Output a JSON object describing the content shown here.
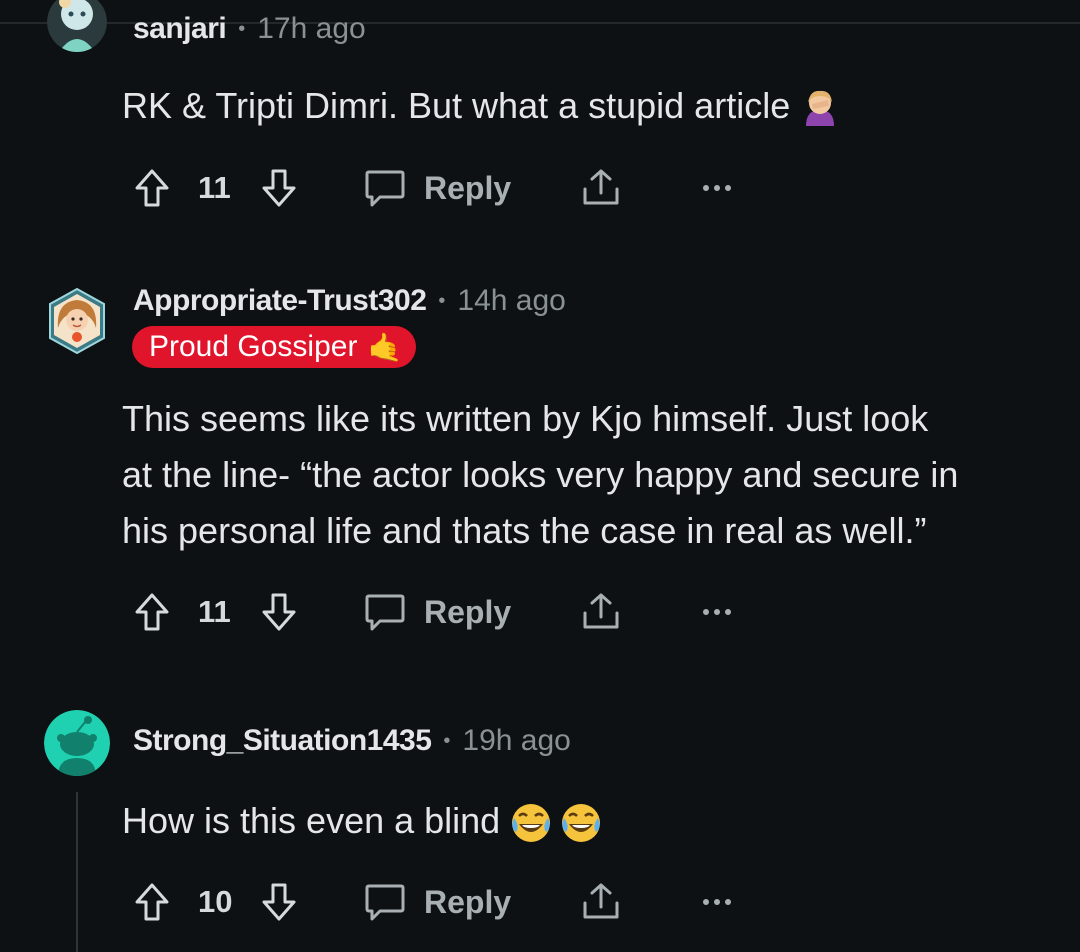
{
  "comments": [
    {
      "username": "sanjari",
      "time": "17h ago",
      "body": "RK & Tripti Dimri. But what a stupid article",
      "body_emoji": "facepalm-emoji",
      "votes": "11",
      "reply_label": "Reply"
    },
    {
      "username": "Appropriate-Trust302",
      "time": "14h ago",
      "flair": "Proud Gossiper",
      "flair_emoji": "🤙",
      "body_lines": [
        "This seems like its written by Kjo himself. Just look",
        "at the line- “the actor looks very happy and secure in",
        "his personal life and thats the case in real as well.”"
      ],
      "votes": "11",
      "reply_label": "Reply"
    },
    {
      "username": "Strong_Situation1435",
      "time": "19h ago",
      "body": "How is this even a blind",
      "body_emoji": "laughing-tears-emoji-x2",
      "votes": "10",
      "reply_label": "Reply"
    }
  ],
  "colors": {
    "background": "#0e1113",
    "flair": "#e0152c",
    "avatar_teal": "#1fd1b0",
    "muted": "#8a9195"
  }
}
